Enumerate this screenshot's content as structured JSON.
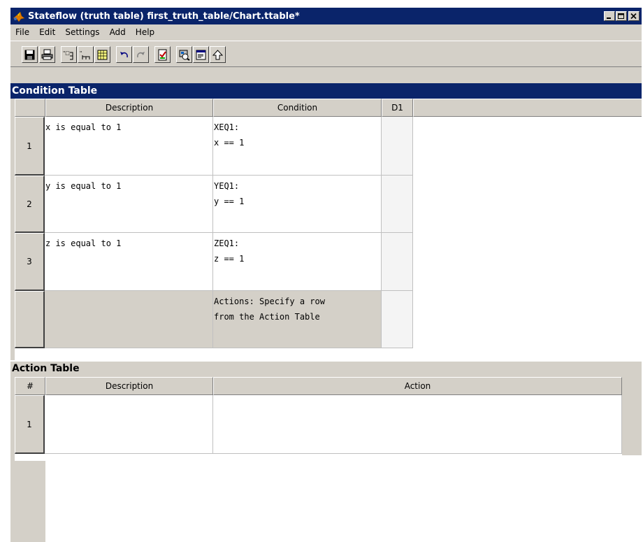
{
  "window": {
    "title": "Stateflow (truth table) first_truth_table/Chart.ttable*",
    "controls": [
      "minimize-icon",
      "maximize-icon",
      "close-icon"
    ]
  },
  "menu": [
    "File",
    "Edit",
    "Settings",
    "Add",
    "Help"
  ],
  "toolbar": {
    "buttons": [
      "save-icon",
      "print-icon",
      "append-row-icon",
      "append-column-icon",
      "edit-data-icon",
      "undo-icon",
      "redo-icon",
      "check-diagnostics-icon",
      "model-explorer-icon",
      "properties-icon",
      "up-to-parent-icon"
    ]
  },
  "condition_table": {
    "title": "Condition Table",
    "headers": [
      "Description",
      "Condition",
      "D1"
    ],
    "rows": [
      {
        "num": "1",
        "description": "x is equal to 1",
        "condition": "XEQ1:\nx == 1",
        "d1": ""
      },
      {
        "num": "2",
        "description": "y is equal to 1",
        "condition": "YEQ1:\ny == 1",
        "d1": ""
      },
      {
        "num": "3",
        "description": "z is equal to 1",
        "condition": "ZEQ1:\nz == 1",
        "d1": ""
      }
    ],
    "actions_row": {
      "num": "",
      "description": "",
      "text": "Actions: Specify a row\nfrom the Action Table",
      "d1": ""
    }
  },
  "action_table": {
    "title": "Action Table",
    "headers": [
      "#",
      "Description",
      "Action"
    ],
    "rows": [
      {
        "num": "1",
        "description": "",
        "action": ""
      }
    ]
  },
  "colors": {
    "title_bar": "#0a246a",
    "chrome": "#d4d0c8",
    "cell_bg": "#ffffff"
  }
}
